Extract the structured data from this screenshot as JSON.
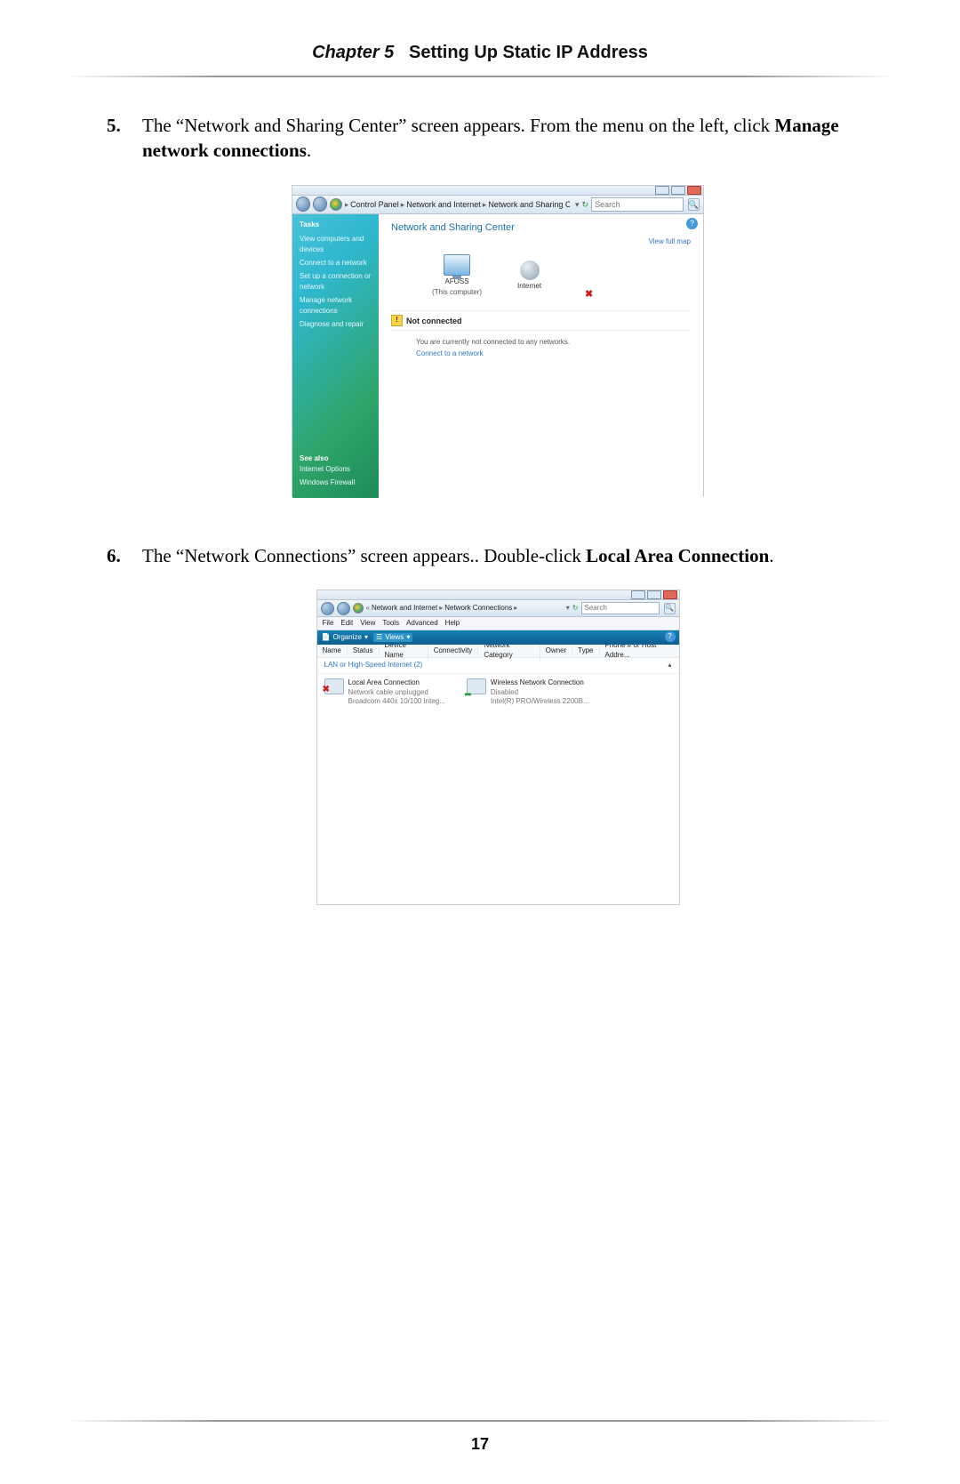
{
  "header": {
    "chapter_label": "Chapter 5",
    "title": "Setting Up Static IP Address"
  },
  "page_number": "17",
  "steps": {
    "s5": {
      "num": "5.",
      "p1": "The “Network and Sharing Center” screen appears. From the menu on the left, click ",
      "b": "Manage network connections",
      "p2": "."
    },
    "s6": {
      "num": "6.",
      "p1": "The “Network Connections” screen appears.. Double-click ",
      "b": "Local Area Connection",
      "p2": "."
    }
  },
  "shot1": {
    "breadcrumb": {
      "a": "Control Panel",
      "b": "Network and Internet",
      "c": "Network and Sharing Center"
    },
    "search_placeholder": "Search",
    "sidebar": {
      "title": "Tasks",
      "links": [
        "View computers and devices",
        "Connect to a network",
        "Set up a connection or network",
        "Manage network connections",
        "Diagnose and repair"
      ],
      "seealso": "See also",
      "seealso_links": [
        "Internet Options",
        "Windows Firewall"
      ]
    },
    "main": {
      "heading": "Network and Sharing Center",
      "viewfullmap": "View full map",
      "node1": "AFOSS",
      "node1_sub": "(This computer)",
      "node2": "Internet",
      "status_label": "Not connected",
      "subtext": "You are currently not connected to any networks.",
      "sublink": "Connect to a network"
    }
  },
  "shot2": {
    "breadcrumb": {
      "a": "Network and Internet",
      "b": "Network Connections"
    },
    "search_placeholder": "Search",
    "menu": [
      "File",
      "Edit",
      "View",
      "Tools",
      "Advanced",
      "Help"
    ],
    "orgbar": {
      "organize": "Organize",
      "views": "Views"
    },
    "columns": [
      "Name",
      "Status",
      "Device Name",
      "Connectivity",
      "Network Category",
      "Owner",
      "Type",
      "Phone # or Host Addre..."
    ],
    "group": "LAN or High-Speed Internet (2)",
    "items": [
      {
        "title": "Local Area Connection",
        "sub1": "Network cable unplugged",
        "sub2": "Broadcom 440x 10/100 Integ...",
        "x": true
      },
      {
        "title": "Wireless Network Connection",
        "sub1": "Disabled",
        "sub2": "Intel(R) PRO/Wireless 2200B...",
        "x": false
      }
    ]
  }
}
